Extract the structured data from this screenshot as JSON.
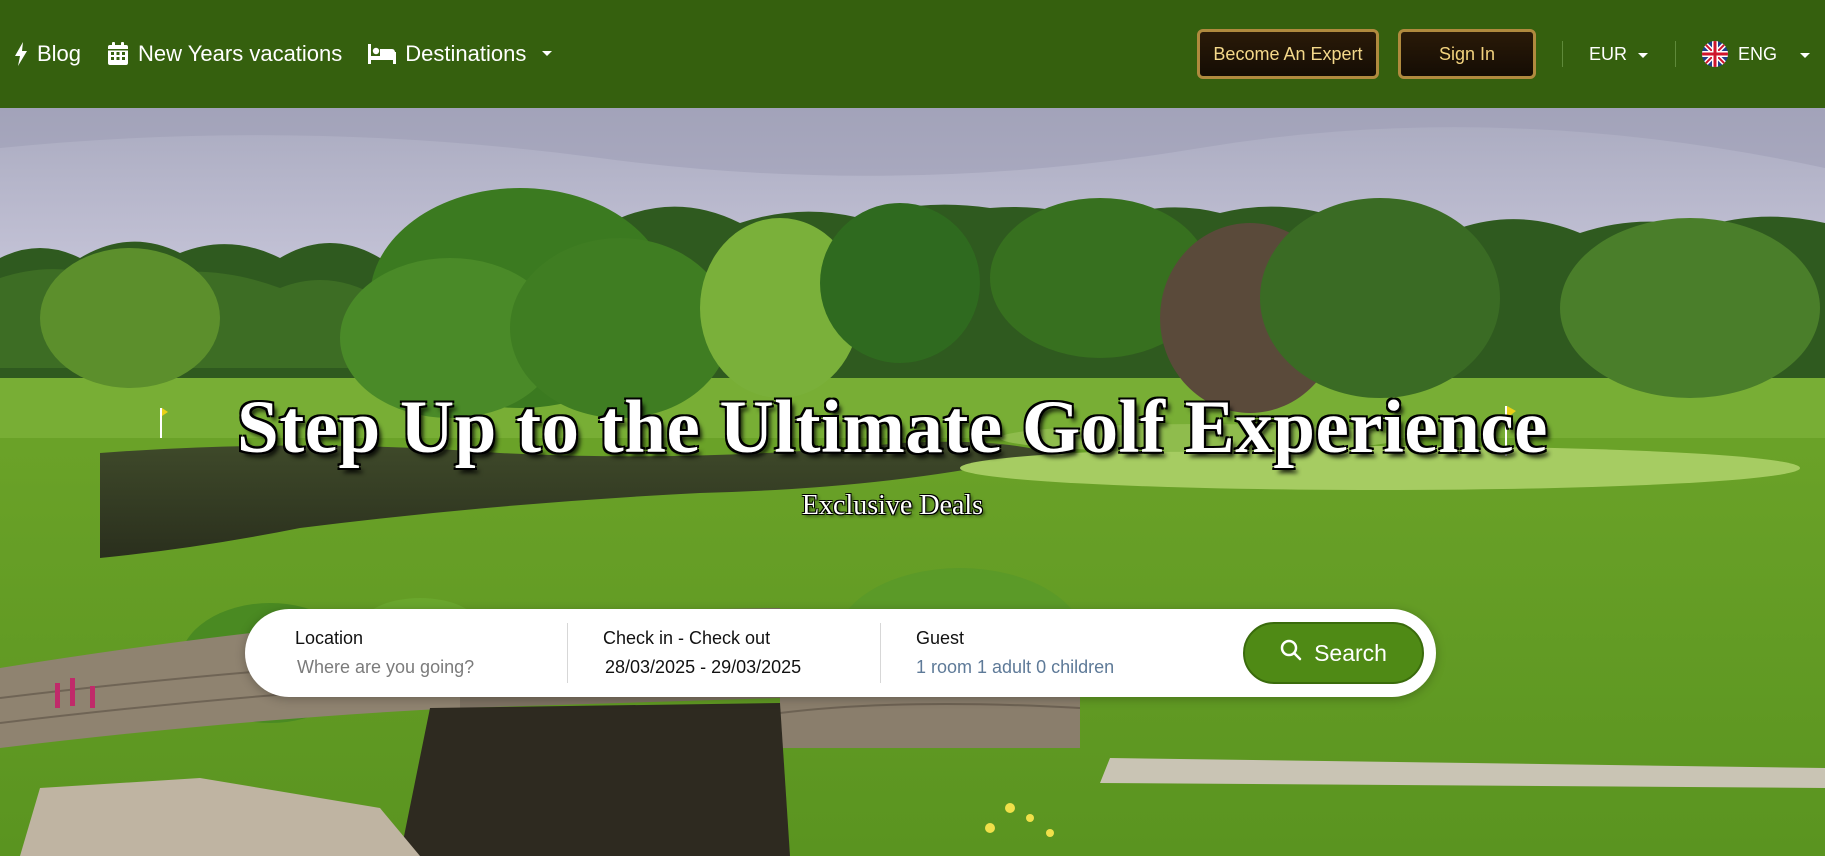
{
  "nav": {
    "blog": "Blog",
    "vacations": "New Years vacations",
    "destinations": "Destinations"
  },
  "header": {
    "become_expert": "Become An Expert",
    "sign_in": "Sign In",
    "currency": "EUR",
    "language": "ENG"
  },
  "hero": {
    "title": "Step Up to the Ultimate Golf Experience",
    "subtitle": "Exclusive Deals"
  },
  "search": {
    "location_label": "Location",
    "location_placeholder": "Where are you going?",
    "dates_label": "Check in - Check out",
    "dates_value": "28/03/2025 - 29/03/2025",
    "guest_label": "Guest",
    "guest_value": "1 room 1 adult 0 children",
    "button": "Search"
  },
  "colors": {
    "nav_bg": "#35600e",
    "gold_text": "#f4d88a",
    "gold_border": "#b08a3e",
    "search_green": "#4f8a15"
  },
  "icons": {
    "blog": "lightning-icon",
    "vacations": "calendar-icon",
    "destinations": "bed-icon",
    "dropdown": "caret-down-icon",
    "language": "uk-flag-icon",
    "search": "search-icon"
  }
}
